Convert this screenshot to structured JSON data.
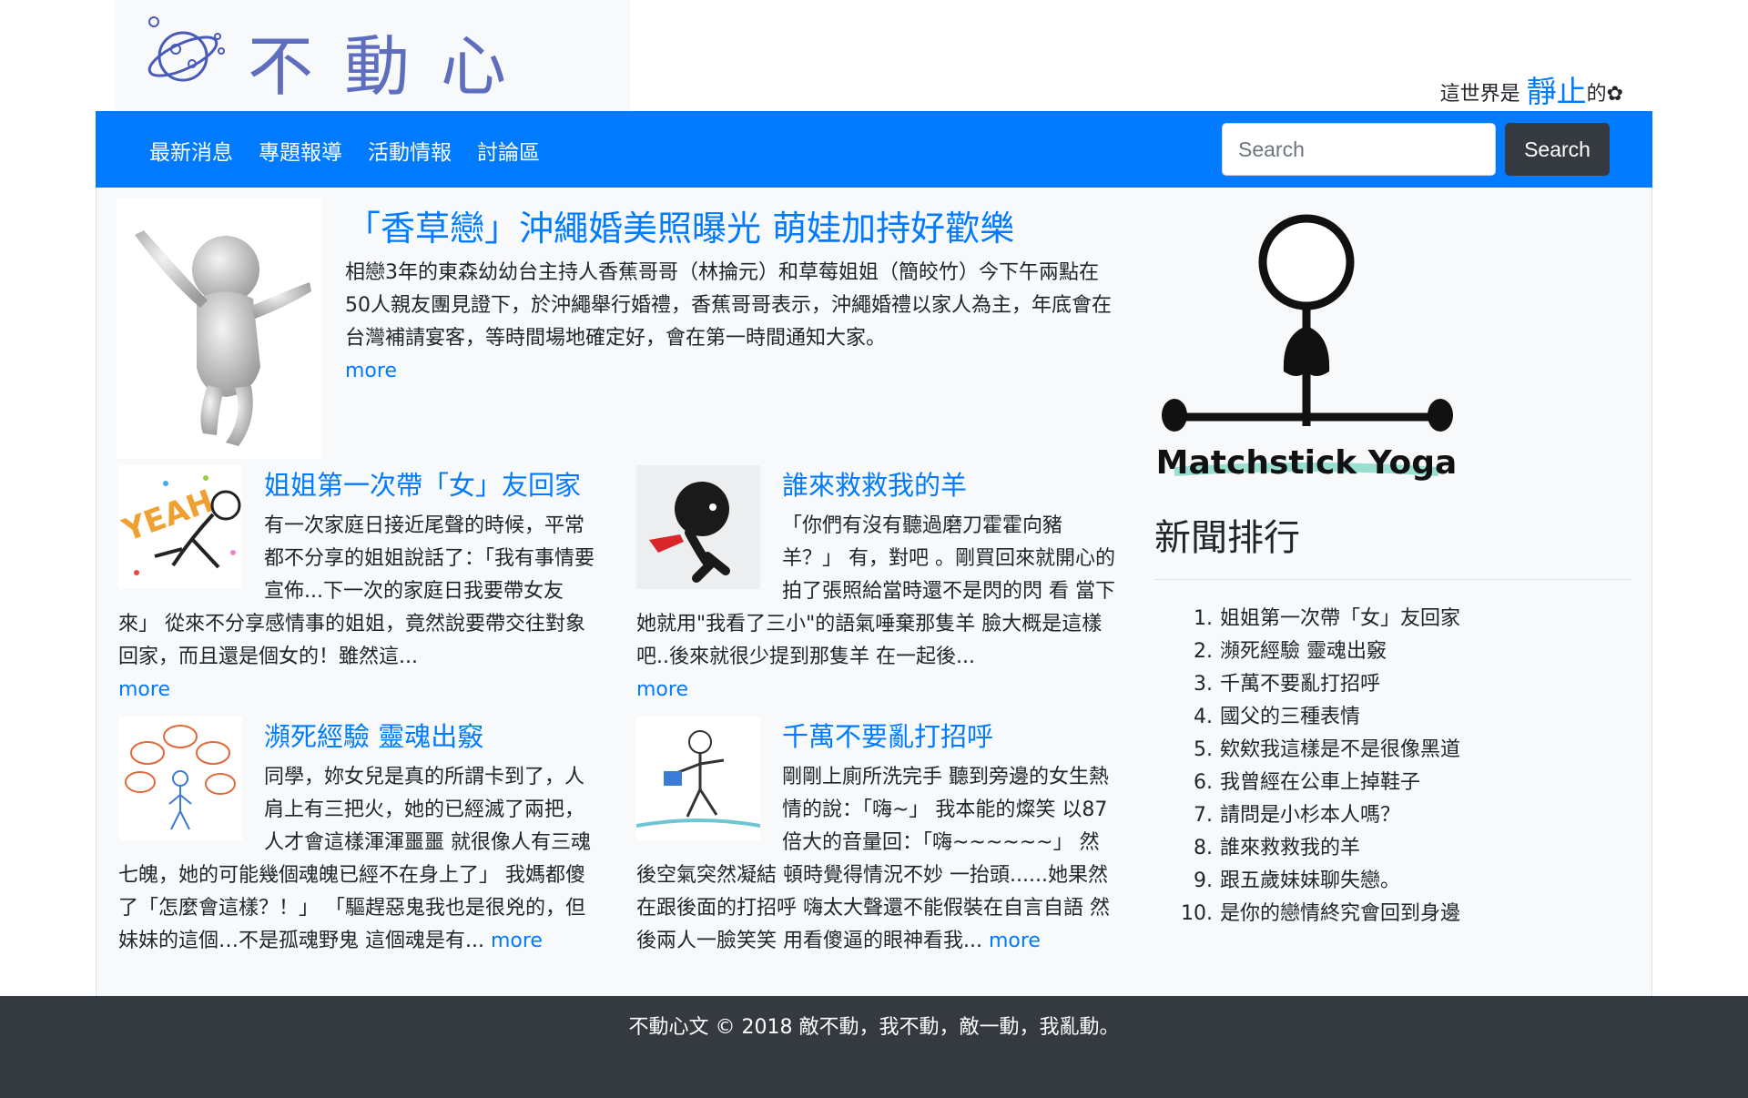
{
  "site": {
    "logo_text": "不動心文",
    "tagline_before": "這世界是 ",
    "tagline_highlight": "靜止",
    "tagline_after": "的✿"
  },
  "nav": {
    "items": [
      "最新消息",
      "專題報導",
      "活動情報",
      "討論區"
    ],
    "search_placeholder": "Search",
    "search_button": "Search"
  },
  "featured": {
    "title": "「香草戀」沖繩婚美照曝光 萌娃加持好歡樂",
    "body": "相戀3年的東森幼幼台主持人香蕉哥哥（林掄元）和草莓姐姐（簡皎竹）今下午兩點在50人親友團見證下，於沖繩舉行婚禮，香蕉哥哥表示，沖繩婚禮以家人為主，年底會在台灣補請宴客，等時間場地確定好，會在第一時間通知大家。",
    "more": "more"
  },
  "articles": [
    {
      "title": "姐姐第一次帶「女」友回家",
      "body": "有一次家庭日接近尾聲的時候，平常都不分享的姐姐說話了：「我有事情要宣佈...下一次的家庭日我要帶女友來」 從來不分享感情事的姐姐，竟然說要帶交往對象回家，而且還是個女的！雖然這...",
      "more": "more"
    },
    {
      "title": "誰來救救我的羊",
      "body": "「你們有沒有聽過磨刀霍霍向豬羊？」 有，對吧 。剛買回來就開心的拍了張照給當時還不是閃的閃 看 當下她就用\"我看了三小\"的語氣唾棄那隻羊 臉大概是這樣吧..後來就很少提到那隻羊 在一起後...",
      "more": "more"
    },
    {
      "title": "瀕死經驗 靈魂出竅",
      "body": "同學，妳女兒是真的所謂卡到了，人肩上有三把火，她的已經滅了兩把，人才會這樣渾渾噩噩 就很像人有三魂七魄，她的可能幾個魂魄已經不在身上了」 我媽都傻了「怎麼會這樣？！」 「驅趕惡鬼我也是很兇的，但妹妹的這個…不是孤魂野鬼 這個魂是有...",
      "more": "more"
    },
    {
      "title": "千萬不要亂打招呼",
      "body": "剛剛上廁所洗完手 聽到旁邊的女生熱情的說：「嗨~」 我本能的燦笑 以87倍大的音量回：「嗨~~~~~~」 然後空氣突然凝結 頓時覺得情況不妙 一抬頭......她果然在跟後面的打招呼 嗨太大聲還不能假裝在自言自語 然後兩人一臉笑笑 用看傻逼的眼神看我...",
      "more": "more"
    }
  ],
  "sidebar": {
    "image_caption": "Matchstick Yoga",
    "ranking_title": "新聞排行",
    "ranking": [
      "姐姐第一次帶「女」友回家",
      "瀕死經驗 靈魂出竅",
      "千萬不要亂打招呼",
      "國父的三種表情",
      "欸欸我這樣是不是很像黑道",
      "我曾經在公車上掉鞋子",
      "請問是小杉本人嗎？",
      "誰來救救我的羊",
      "跟五歲妹妹聊失戀。",
      "是你的戀情終究會回到身邊"
    ]
  },
  "footer": {
    "text": "不動心文 © 2018 敵不動，我不動，敵一動，我亂動。"
  },
  "colors": {
    "primary": "#007bff",
    "dark": "#343a40",
    "light": "#f8f9fa"
  }
}
